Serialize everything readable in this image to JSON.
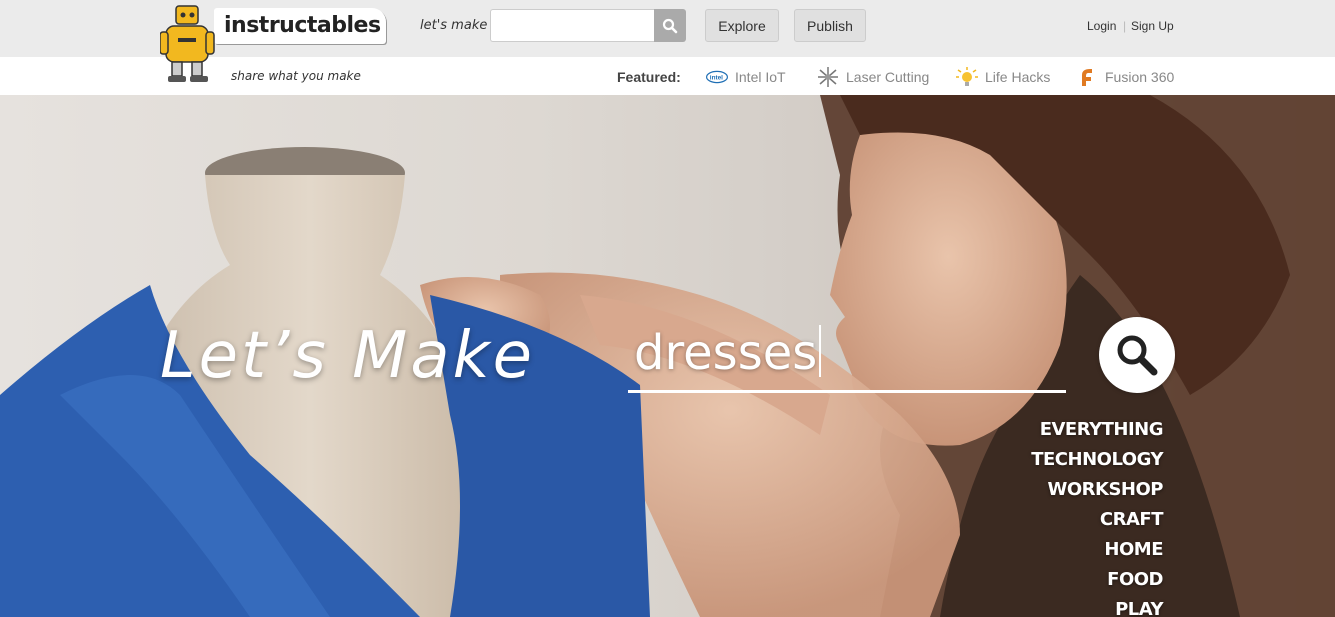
{
  "header": {
    "logo_text": "instructables",
    "tagline": "share what you make",
    "search_label": "let's make",
    "search_placeholder": "",
    "explore_label": "Explore",
    "publish_label": "Publish",
    "login_label": "Login",
    "separator": "|",
    "signup_label": "Sign Up"
  },
  "featured": {
    "label": "Featured:",
    "items": [
      {
        "label": "Intel IoT",
        "icon": "intel-icon"
      },
      {
        "label": "Laser Cutting",
        "icon": "laser-icon"
      },
      {
        "label": "Life Hacks",
        "icon": "lightbulb-icon"
      },
      {
        "label": "Fusion 360",
        "icon": "fusion-icon"
      }
    ]
  },
  "hero": {
    "title": "Let’s Make",
    "search_value": "dresses",
    "categories": [
      "EVERYTHING",
      "TECHNOLOGY",
      "WORKSHOP",
      "CRAFT",
      "HOME",
      "FOOD",
      "PLAY"
    ]
  },
  "colors": {
    "topbar_bg": "#ebebeb",
    "robot_yellow": "#f2b81f",
    "dress_blue": "#2d5fb0"
  }
}
